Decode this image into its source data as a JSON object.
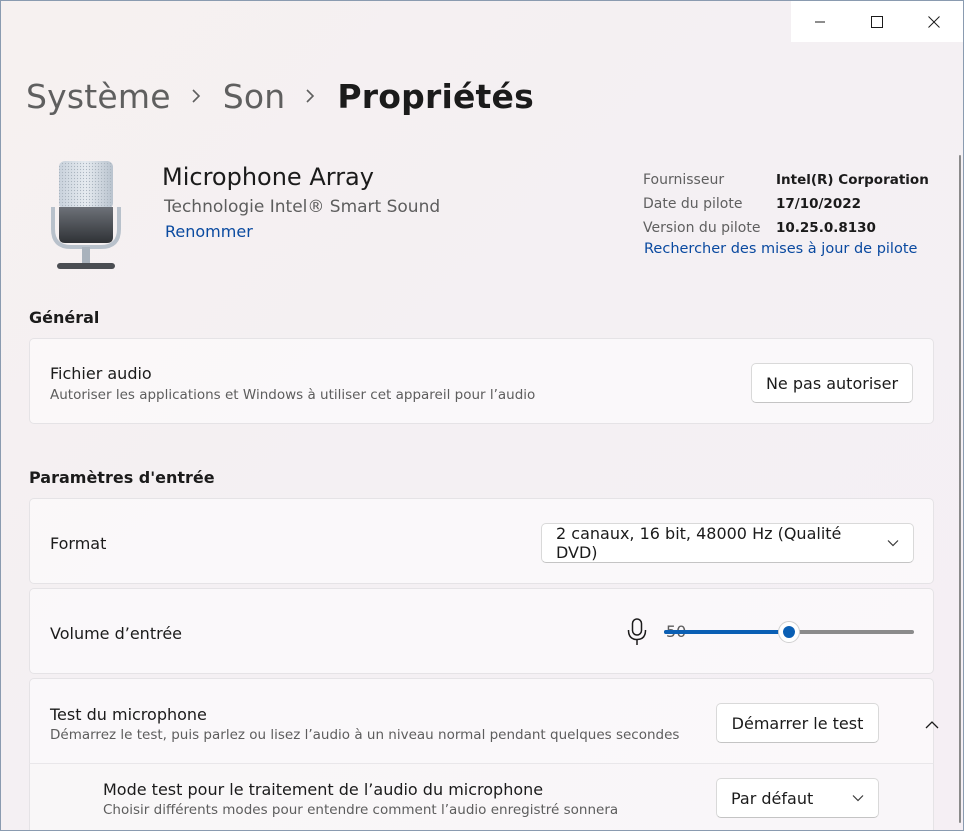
{
  "window": {
    "caption": {
      "minimize_icon": "minimize-icon",
      "maximize_icon": "maximize-icon",
      "close_icon": "close-icon"
    }
  },
  "breadcrumb": {
    "items": [
      "Système",
      "Son",
      "Propriétés"
    ],
    "separator_icon": "chevron-right-icon"
  },
  "device": {
    "name": "Microphone Array",
    "description": "Technologie Intel® Smart Sound",
    "rename_link": "Renommer",
    "icon": "microphone-image",
    "properties": [
      {
        "label": "Fournisseur",
        "value": "Intel(R) Corporation"
      },
      {
        "label": "Date du pilote",
        "value": "17/10/2022"
      },
      {
        "label": "Version du pilote",
        "value": "10.25.0.8130"
      }
    ],
    "driver_update_link": "Rechercher des mises à jour de pilote"
  },
  "general": {
    "heading": "Général",
    "audio_file": {
      "title": "Fichier audio",
      "subtitle": "Autoriser les applications et Windows à utiliser cet appareil pour l’audio",
      "button": "Ne pas autoriser"
    }
  },
  "input_settings": {
    "heading": "Paramètres d'entrée",
    "format": {
      "title": "Format",
      "selected": "2 canaux, 16 bit, 48000 Hz (Qualité DVD)"
    },
    "volume": {
      "title": "Volume d’entrée",
      "value": "50",
      "level_fraction": 0.5,
      "icon": "microphone-icon"
    },
    "mic_test": {
      "title": "Test du microphone",
      "subtitle": "Démarrez le test, puis parlez ou lisez l’audio à un niveau normal pendant quelques secondes",
      "button": "Démarrer le test",
      "expand_icon": "chevron-up-icon"
    },
    "test_mode": {
      "title": "Mode test pour le traitement de l’audio du microphone",
      "subtitle": "Choisir différents modes pour entendre comment l’audio enregistré sonnera",
      "selected": "Par défaut"
    }
  },
  "colors": {
    "accent": "#0a5fb4",
    "link": "#0a4aa0",
    "text_primary": "#1b1b1b",
    "text_secondary": "#5d5d5d"
  }
}
